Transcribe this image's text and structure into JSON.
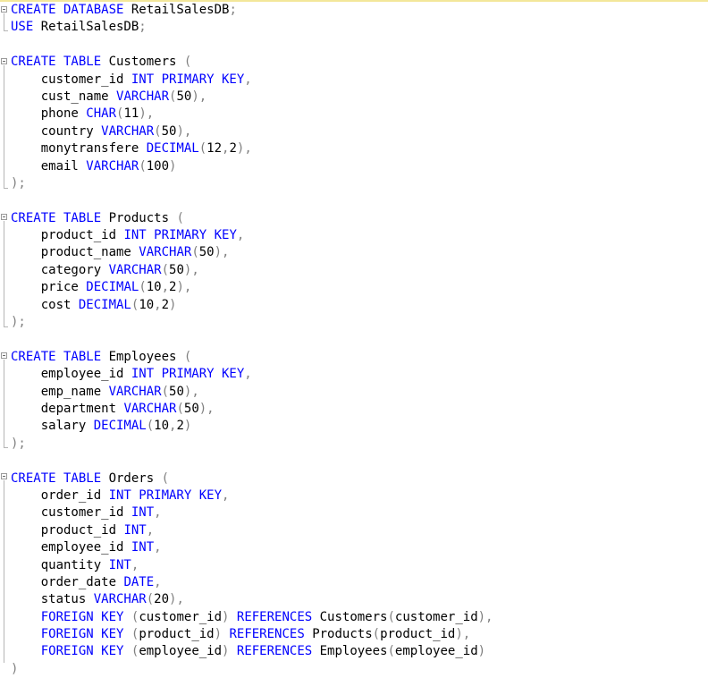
{
  "editor": {
    "code_lines": [
      [
        {
          "t": "CREATE DATABASE ",
          "k": "kw"
        },
        {
          "t": "RetailSalesDB",
          "k": ""
        },
        {
          "t": ";",
          "k": "pn"
        }
      ],
      [
        {
          "t": "USE ",
          "k": "kw"
        },
        {
          "t": "RetailSalesDB",
          "k": ""
        },
        {
          "t": ";",
          "k": "pn"
        }
      ],
      [],
      [
        {
          "t": "CREATE TABLE ",
          "k": "kw"
        },
        {
          "t": "Customers ",
          "k": ""
        },
        {
          "t": "(",
          "k": "pn"
        }
      ],
      [
        {
          "t": "    customer_id ",
          "k": ""
        },
        {
          "t": "INT PRIMARY KEY",
          "k": "kw"
        },
        {
          "t": ",",
          "k": "pn"
        }
      ],
      [
        {
          "t": "    cust_name ",
          "k": ""
        },
        {
          "t": "VARCHAR",
          "k": "kw"
        },
        {
          "t": "(",
          "k": "pn"
        },
        {
          "t": "50",
          "k": ""
        },
        {
          "t": "),",
          "k": "pn"
        }
      ],
      [
        {
          "t": "    phone ",
          "k": ""
        },
        {
          "t": "CHAR",
          "k": "kw"
        },
        {
          "t": "(",
          "k": "pn"
        },
        {
          "t": "11",
          "k": ""
        },
        {
          "t": "),",
          "k": "pn"
        }
      ],
      [
        {
          "t": "    country ",
          "k": ""
        },
        {
          "t": "VARCHAR",
          "k": "kw"
        },
        {
          "t": "(",
          "k": "pn"
        },
        {
          "t": "50",
          "k": ""
        },
        {
          "t": "),",
          "k": "pn"
        }
      ],
      [
        {
          "t": "    monytransfere ",
          "k": ""
        },
        {
          "t": "DECIMAL",
          "k": "kw"
        },
        {
          "t": "(",
          "k": "pn"
        },
        {
          "t": "12",
          "k": ""
        },
        {
          "t": ",",
          "k": "pn"
        },
        {
          "t": "2",
          "k": ""
        },
        {
          "t": "),",
          "k": "pn"
        }
      ],
      [
        {
          "t": "    email ",
          "k": ""
        },
        {
          "t": "VARCHAR",
          "k": "kw"
        },
        {
          "t": "(",
          "k": "pn"
        },
        {
          "t": "100",
          "k": ""
        },
        {
          "t": ")",
          "k": "pn"
        }
      ],
      [
        {
          "t": ");",
          "k": "pn"
        }
      ],
      [],
      [
        {
          "t": "CREATE TABLE ",
          "k": "kw"
        },
        {
          "t": "Products ",
          "k": ""
        },
        {
          "t": "(",
          "k": "pn"
        }
      ],
      [
        {
          "t": "    product_id ",
          "k": ""
        },
        {
          "t": "INT PRIMARY KEY",
          "k": "kw"
        },
        {
          "t": ",",
          "k": "pn"
        }
      ],
      [
        {
          "t": "    product_name ",
          "k": ""
        },
        {
          "t": "VARCHAR",
          "k": "kw"
        },
        {
          "t": "(",
          "k": "pn"
        },
        {
          "t": "50",
          "k": ""
        },
        {
          "t": "),",
          "k": "pn"
        }
      ],
      [
        {
          "t": "    category ",
          "k": ""
        },
        {
          "t": "VARCHAR",
          "k": "kw"
        },
        {
          "t": "(",
          "k": "pn"
        },
        {
          "t": "50",
          "k": ""
        },
        {
          "t": "),",
          "k": "pn"
        }
      ],
      [
        {
          "t": "    price ",
          "k": ""
        },
        {
          "t": "DECIMAL",
          "k": "kw"
        },
        {
          "t": "(",
          "k": "pn"
        },
        {
          "t": "10",
          "k": ""
        },
        {
          "t": ",",
          "k": "pn"
        },
        {
          "t": "2",
          "k": ""
        },
        {
          "t": "),",
          "k": "pn"
        }
      ],
      [
        {
          "t": "    cost ",
          "k": ""
        },
        {
          "t": "DECIMAL",
          "k": "kw"
        },
        {
          "t": "(",
          "k": "pn"
        },
        {
          "t": "10",
          "k": ""
        },
        {
          "t": ",",
          "k": "pn"
        },
        {
          "t": "2",
          "k": ""
        },
        {
          "t": ")",
          "k": "pn"
        }
      ],
      [
        {
          "t": ");",
          "k": "pn"
        }
      ],
      [],
      [
        {
          "t": "CREATE TABLE ",
          "k": "kw"
        },
        {
          "t": "Employees ",
          "k": ""
        },
        {
          "t": "(",
          "k": "pn"
        }
      ],
      [
        {
          "t": "    employee_id ",
          "k": ""
        },
        {
          "t": "INT PRIMARY KEY",
          "k": "kw"
        },
        {
          "t": ",",
          "k": "pn"
        }
      ],
      [
        {
          "t": "    emp_name ",
          "k": ""
        },
        {
          "t": "VARCHAR",
          "k": "kw"
        },
        {
          "t": "(",
          "k": "pn"
        },
        {
          "t": "50",
          "k": ""
        },
        {
          "t": "),",
          "k": "pn"
        }
      ],
      [
        {
          "t": "    department ",
          "k": ""
        },
        {
          "t": "VARCHAR",
          "k": "kw"
        },
        {
          "t": "(",
          "k": "pn"
        },
        {
          "t": "50",
          "k": ""
        },
        {
          "t": "),",
          "k": "pn"
        }
      ],
      [
        {
          "t": "    salary ",
          "k": ""
        },
        {
          "t": "DECIMAL",
          "k": "kw"
        },
        {
          "t": "(",
          "k": "pn"
        },
        {
          "t": "10",
          "k": ""
        },
        {
          "t": ",",
          "k": "pn"
        },
        {
          "t": "2",
          "k": ""
        },
        {
          "t": ")",
          "k": "pn"
        }
      ],
      [
        {
          "t": ");",
          "k": "pn"
        }
      ],
      [],
      [
        {
          "t": "CREATE TABLE ",
          "k": "kw"
        },
        {
          "t": "Orders ",
          "k": ""
        },
        {
          "t": "(",
          "k": "pn"
        }
      ],
      [
        {
          "t": "    order_id ",
          "k": ""
        },
        {
          "t": "INT PRIMARY KEY",
          "k": "kw"
        },
        {
          "t": ",",
          "k": "pn"
        }
      ],
      [
        {
          "t": "    customer_id ",
          "k": ""
        },
        {
          "t": "INT",
          "k": "kw"
        },
        {
          "t": ",",
          "k": "pn"
        }
      ],
      [
        {
          "t": "    product_id ",
          "k": ""
        },
        {
          "t": "INT",
          "k": "kw"
        },
        {
          "t": ",",
          "k": "pn"
        }
      ],
      [
        {
          "t": "    employee_id ",
          "k": ""
        },
        {
          "t": "INT",
          "k": "kw"
        },
        {
          "t": ",",
          "k": "pn"
        }
      ],
      [
        {
          "t": "    quantity ",
          "k": ""
        },
        {
          "t": "INT",
          "k": "kw"
        },
        {
          "t": ",",
          "k": "pn"
        }
      ],
      [
        {
          "t": "    order_date ",
          "k": ""
        },
        {
          "t": "DATE",
          "k": "kw"
        },
        {
          "t": ",",
          "k": "pn"
        }
      ],
      [
        {
          "t": "    status ",
          "k": ""
        },
        {
          "t": "VARCHAR",
          "k": "kw"
        },
        {
          "t": "(",
          "k": "pn"
        },
        {
          "t": "20",
          "k": ""
        },
        {
          "t": "),",
          "k": "pn"
        }
      ],
      [
        {
          "t": "    ",
          "k": ""
        },
        {
          "t": "FOREIGN KEY ",
          "k": "kw"
        },
        {
          "t": "(",
          "k": "pn"
        },
        {
          "t": "customer_id",
          "k": ""
        },
        {
          "t": ") ",
          "k": "pn"
        },
        {
          "t": "REFERENCES ",
          "k": "kw"
        },
        {
          "t": "Customers",
          "k": ""
        },
        {
          "t": "(",
          "k": "pn"
        },
        {
          "t": "customer_id",
          "k": ""
        },
        {
          "t": "),",
          "k": "pn"
        }
      ],
      [
        {
          "t": "    ",
          "k": ""
        },
        {
          "t": "FOREIGN KEY ",
          "k": "kw"
        },
        {
          "t": "(",
          "k": "pn"
        },
        {
          "t": "product_id",
          "k": ""
        },
        {
          "t": ") ",
          "k": "pn"
        },
        {
          "t": "REFERENCES ",
          "k": "kw"
        },
        {
          "t": "Products",
          "k": ""
        },
        {
          "t": "(",
          "k": "pn"
        },
        {
          "t": "product_id",
          "k": ""
        },
        {
          "t": "),",
          "k": "pn"
        }
      ],
      [
        {
          "t": "    ",
          "k": ""
        },
        {
          "t": "FOREIGN KEY ",
          "k": "kw"
        },
        {
          "t": "(",
          "k": "pn"
        },
        {
          "t": "employee_id",
          "k": ""
        },
        {
          "t": ") ",
          "k": "pn"
        },
        {
          "t": "REFERENCES ",
          "k": "kw"
        },
        {
          "t": "Employees",
          "k": ""
        },
        {
          "t": "(",
          "k": "pn"
        },
        {
          "t": "employee_id",
          "k": ""
        },
        {
          "t": ")",
          "k": "pn"
        }
      ],
      [
        {
          "t": ")",
          "k": "pn"
        }
      ]
    ]
  },
  "colors": {
    "keyword": "#0000ff",
    "punctuation": "#808080",
    "identifier": "#000000",
    "background": "#ffffff",
    "top_rule": "#f3e79a"
  }
}
